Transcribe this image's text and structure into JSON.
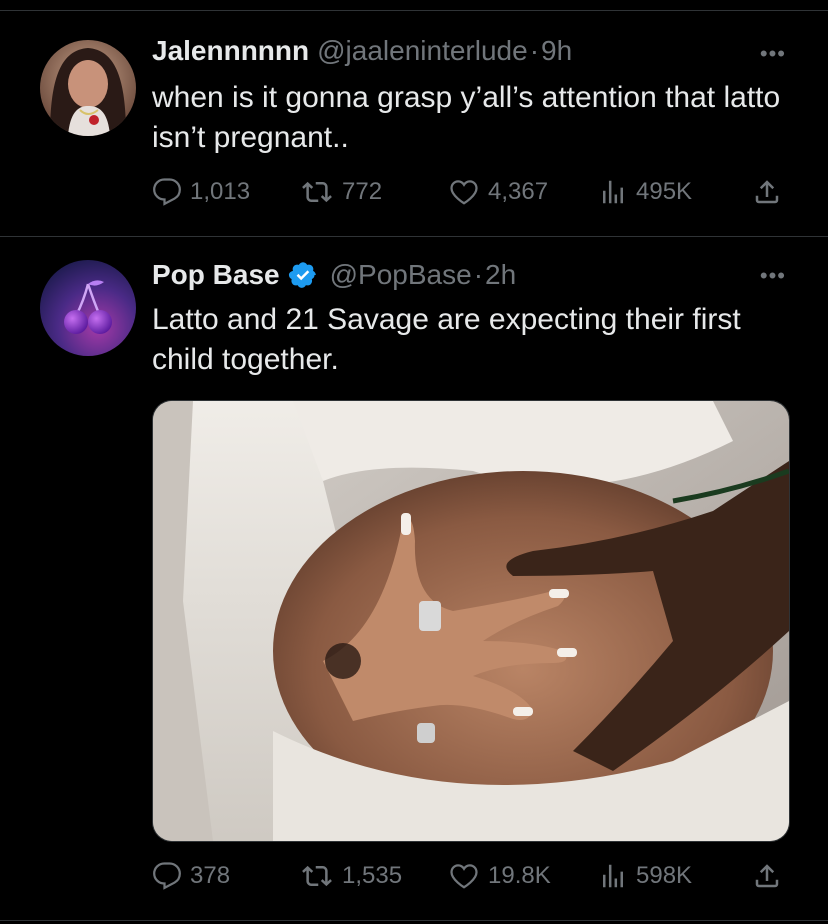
{
  "tweets": [
    {
      "name": "Jalennnnnn",
      "handle": "@jaaleninterlude",
      "time": "9h",
      "text": "when is it gonna grasp y’all’s attention that latto isn’t pregnant..",
      "replies": "1,013",
      "retweets": "772",
      "likes": "4,367",
      "views": "495K"
    },
    {
      "name": "Pop Base",
      "handle": "@PopBase",
      "time": "2h",
      "verified": true,
      "text": "Latto and 21 Savage are expecting their first child together.",
      "replies": "378",
      "retweets": "1,535",
      "likes": "19.8K",
      "views": "598K",
      "media_description": "photo of hands on pregnant belly"
    }
  ],
  "ui": {
    "separator": "·",
    "more_glyph": "•••",
    "accent_verified": "#1d9bf0",
    "muted_text": "#71767b",
    "primary_text": "#e7e9ea",
    "background": "#000000"
  }
}
